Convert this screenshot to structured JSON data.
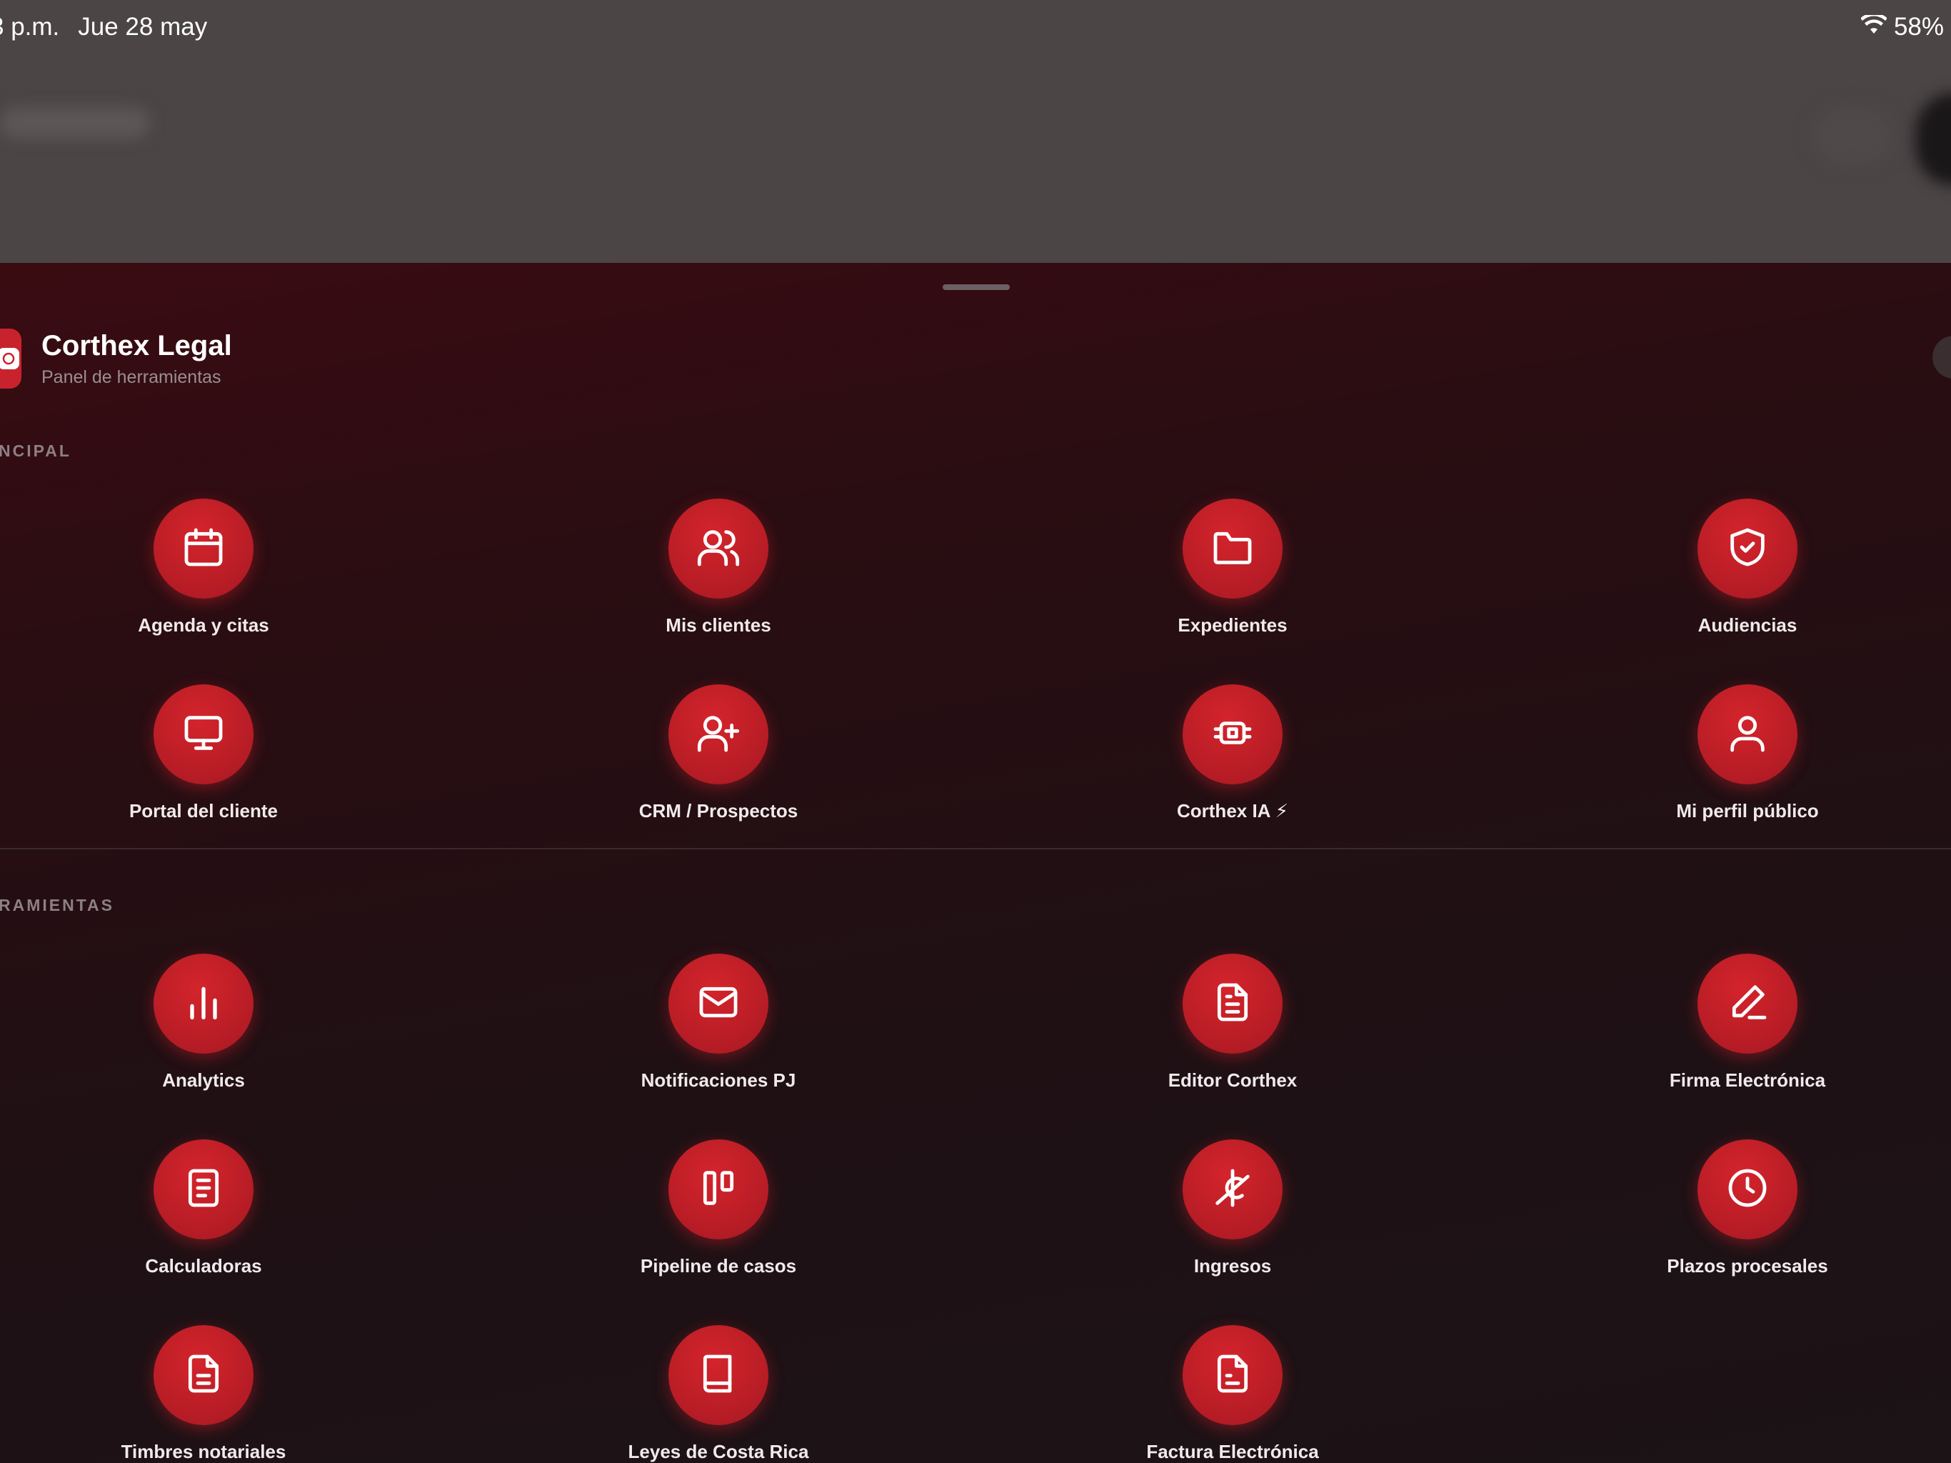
{
  "status_bar": {
    "time": "3 p.m.",
    "date": "Jue 28 may",
    "battery": "58%"
  },
  "header": {
    "title": "Corthex Legal",
    "subtitle": "Panel de herramientas"
  },
  "sections": [
    {
      "label": "NCIPAL"
    },
    {
      "label": "RAMIENTAS"
    }
  ],
  "tools": [
    {
      "label": "Agenda y citas",
      "icon": "calendar-icon"
    },
    {
      "label": "Mis clientes",
      "icon": "users-icon"
    },
    {
      "label": "Expedientes",
      "icon": "folder-icon"
    },
    {
      "label": "Audiencias",
      "icon": "shield-check-icon"
    },
    {
      "label": "Portal del cliente",
      "icon": "monitor-icon"
    },
    {
      "label": "CRM / Prospectos",
      "icon": "user-plus-icon"
    },
    {
      "label": "Corthex IA ⚡",
      "icon": "cpu-icon"
    },
    {
      "label": "Mi perfil público",
      "icon": "user-icon"
    },
    {
      "label": "Analytics",
      "icon": "bar-chart-icon"
    },
    {
      "label": "Notificaciones PJ",
      "icon": "mail-icon"
    },
    {
      "label": "Editor Corthex",
      "icon": "file-text-icon"
    },
    {
      "label": "Firma Electrónica",
      "icon": "pen-icon"
    },
    {
      "label": "Calculadoras",
      "icon": "calculator-doc-icon"
    },
    {
      "label": "Pipeline de casos",
      "icon": "kanban-icon"
    },
    {
      "label": "Ingresos",
      "icon": "coins-icon"
    },
    {
      "label": "Plazos procesales",
      "icon": "clock-icon"
    },
    {
      "label": "Timbres notariales",
      "icon": "file-lines-icon"
    },
    {
      "label": "Leyes de Costa Rica",
      "icon": "book-icon"
    },
    {
      "label": "Factura Electrónica",
      "icon": "invoice-icon"
    }
  ],
  "colors": {
    "accent": "#c8232c",
    "sheet_bg": "#1f1014",
    "backdrop": "#4b4546"
  }
}
